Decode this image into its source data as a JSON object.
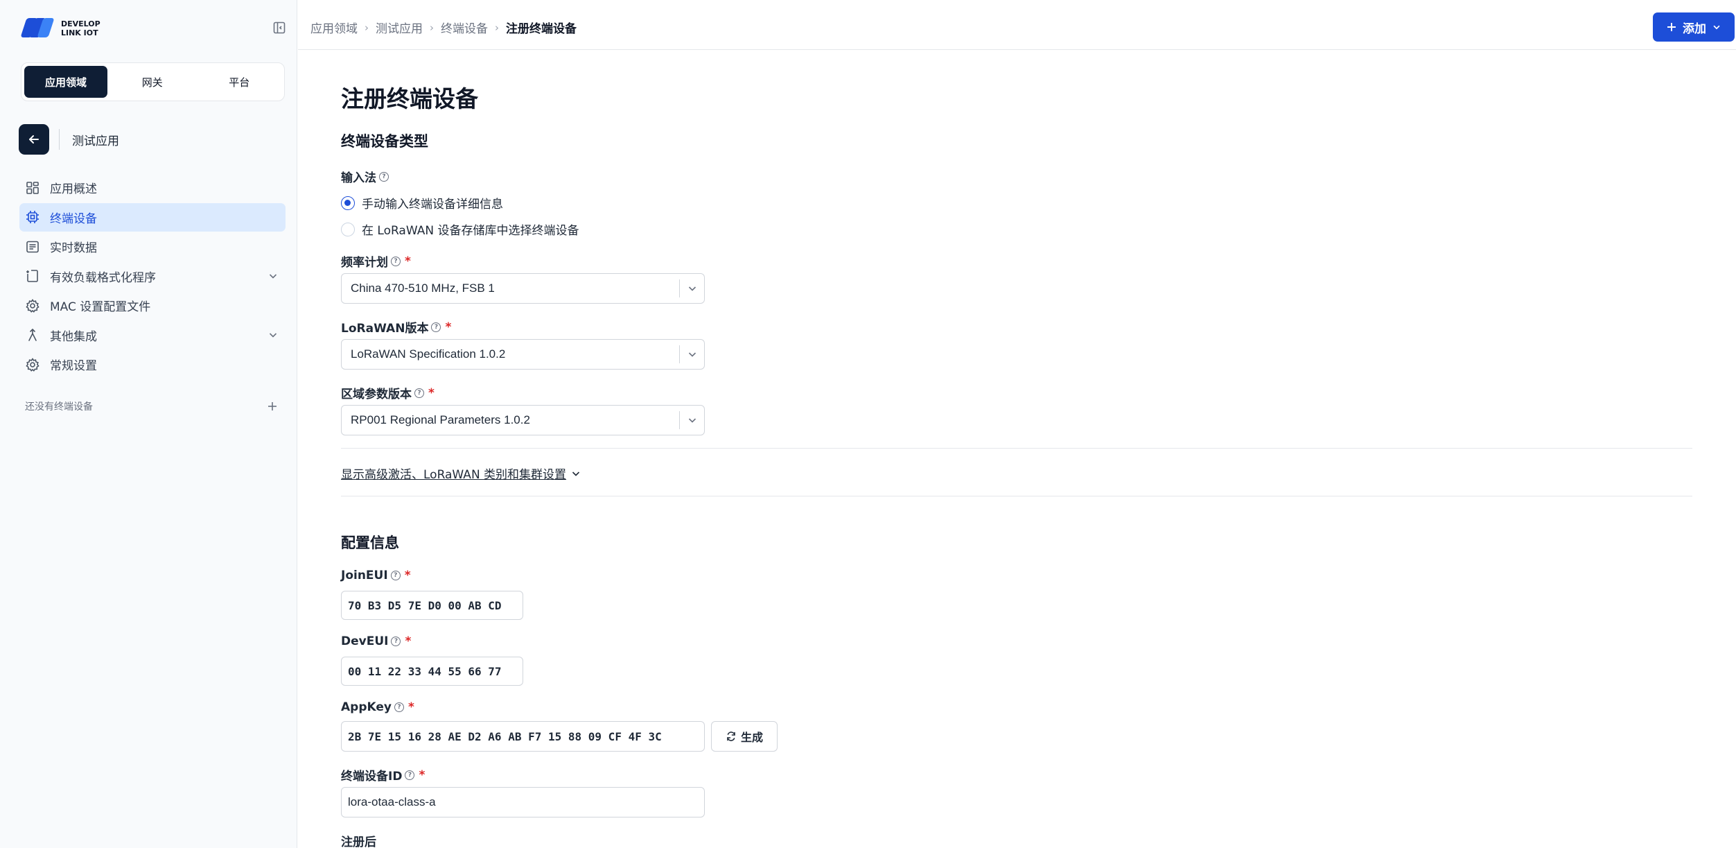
{
  "brand": {
    "line1": "DEVELOP",
    "line2": "LINK IOT",
    "accent": "#1d4ed8",
    "dark": "#0f1e35"
  },
  "segments": [
    "应用领域",
    "网关",
    "平台"
  ],
  "back_label": "测试应用",
  "nav": [
    {
      "label": "应用概述",
      "icon": "dashboard-icon"
    },
    {
      "label": "终端设备",
      "icon": "chip-icon",
      "active": true
    },
    {
      "label": "实时数据",
      "icon": "list-icon"
    },
    {
      "label": "有效负载格式化程序",
      "icon": "code-file-icon",
      "expandable": true
    },
    {
      "label": "MAC 设置配置文件",
      "icon": "gear-icon"
    },
    {
      "label": "其他集成",
      "icon": "integration-icon",
      "expandable": true
    },
    {
      "label": "常规设置",
      "icon": "gear-icon"
    }
  ],
  "empty_devices": "还没有终端设备",
  "breadcrumb": [
    "应用领域",
    "测试应用",
    "终端设备",
    "注册终端设备"
  ],
  "add_button": "添加",
  "page_title": "注册终端设备",
  "section_device_type": "终端设备类型",
  "input_method": {
    "label": "输入法",
    "options": [
      "手动输入终端设备详细信息",
      "在 LoRaWAN 设备存储库中选择终端设备"
    ],
    "selected": 0
  },
  "frequency_plan": {
    "label": "频率计划",
    "value": "China 470-510 MHz, FSB 1"
  },
  "lorawan_version": {
    "label": "LoRaWAN版本",
    "value": "LoRaWAN Specification 1.0.2"
  },
  "regional_params": {
    "label": "区域参数版本",
    "value": "RP001 Regional Parameters 1.0.2"
  },
  "advanced_link": "显示高级激活、LoRaWAN 类别和集群设置",
  "section_config": "配置信息",
  "join_eui": {
    "label": "JoinEUI",
    "value": "70 B3 D5 7E D0 00 AB CD"
  },
  "dev_eui": {
    "label": "DevEUI",
    "value": "00 11 22 33 44 55 66 77"
  },
  "app_key": {
    "label": "AppKey",
    "value": "2B 7E 15 16 28 AE D2 A6 AB F7 15 88 09 CF 4F 3C",
    "generate": "生成"
  },
  "device_id": {
    "label": "终端设备ID",
    "value": "lora-otaa-class-a"
  },
  "after_register": {
    "label": "注册后"
  },
  "required_mark": "*",
  "help_mark": "?"
}
